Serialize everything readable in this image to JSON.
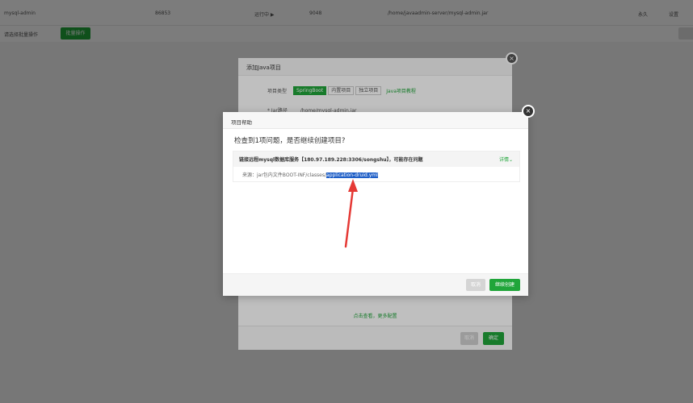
{
  "background": {
    "row": {
      "name": "mysql-admin",
      "pid": "86853",
      "status": "运行中 ▶",
      "port": "9048",
      "path": "/home/javaadmin-server/mysql-admin.jar",
      "col6": "永久",
      "col7": "设置"
    },
    "toolbar_label": "请选择批量操作",
    "toolbar_button": "批量操作"
  },
  "outer_dialog": {
    "title": "添加Java项目",
    "type_label": "项目类型",
    "types": [
      "SpringBoot",
      "内置项目",
      "独立项目"
    ],
    "tutorial_link": "Java项目教程",
    "jar_label": "* Jar路径",
    "jar_value": "/home/mysql-admin.jar",
    "more_config": "点击查看，更多配置",
    "cancel": "取消",
    "confirm": "确定"
  },
  "help_dialog": {
    "title": "项目帮助",
    "question": "检查到1项问题，是否继续创建项目?",
    "issue_title": "链接远程mysql数据库服务【180.97.189.228:3306/songshu】，可能存在问题",
    "detail_link": "详情",
    "source_prefix": "来源：jar包内文件BOOT-INF/classes/",
    "source_file": "application-druid.yml",
    "cancel": "取消",
    "continue": "继续创建"
  },
  "colors": {
    "accent": "#20a53a",
    "highlight": "#1f5fc7",
    "arrow": "#e53935"
  }
}
